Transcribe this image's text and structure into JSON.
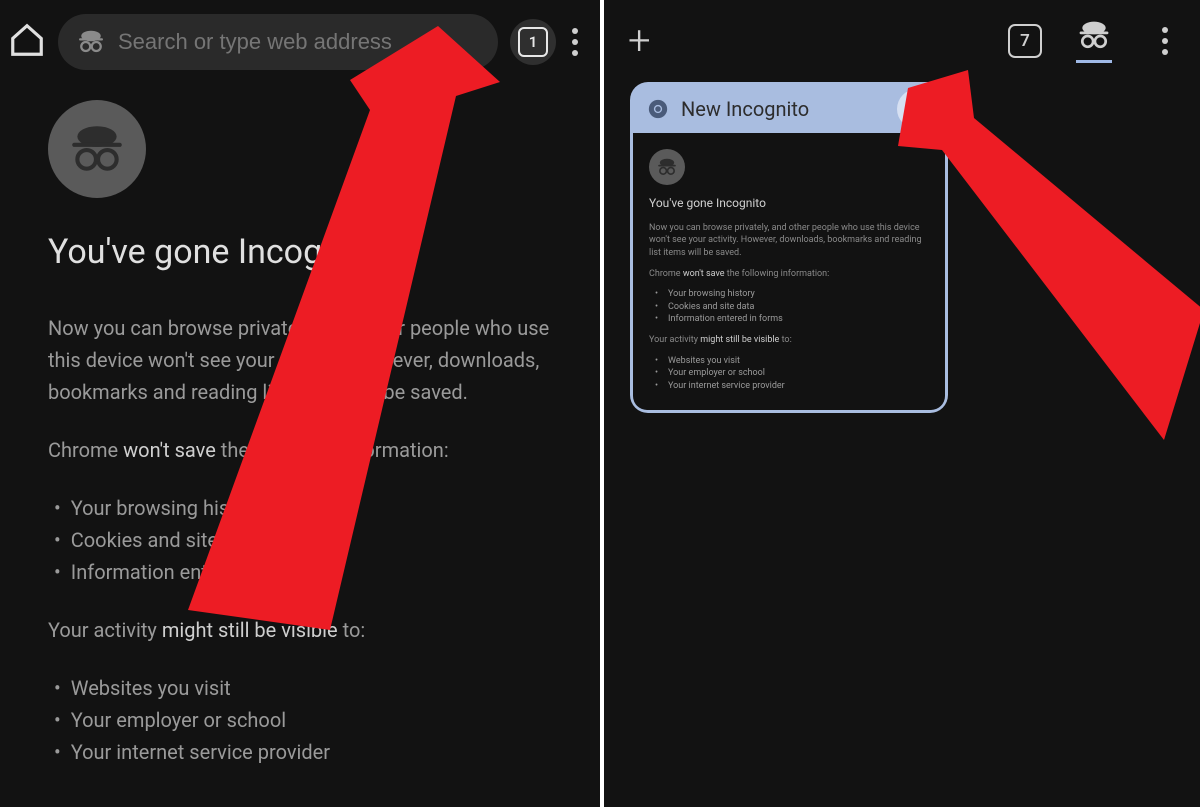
{
  "left": {
    "search_placeholder": "Search or type web address",
    "tab_count": "1",
    "heading": "You've gone Incognito",
    "intro": "Now you can browse privately, and other people who use this device won't see your activity. However, downloads, bookmarks and reading list items will be saved.",
    "wont_save_lead": "Chrome ",
    "wont_save_hl": "won't save",
    "wont_save_tail": " the following information:",
    "wont_save_items": [
      "Your browsing history",
      "Cookies and site data",
      "Information entered in forms"
    ],
    "visible_lead": "Your activity ",
    "visible_hl": "might still be visible",
    "visible_tail": " to:",
    "visible_items": [
      "Websites you visit",
      "Your employer or school",
      "Your internet service provider"
    ]
  },
  "right": {
    "tab_count": "7",
    "card_title": "New Incognito"
  },
  "thumb": {
    "heading": "You've gone Incognito",
    "intro": "Now you can browse privately, and other people who use this device won't see your activity. However, downloads, bookmarks and reading list items will be saved.",
    "wont_save_lead": "Chrome ",
    "wont_save_hl": "won't save",
    "wont_save_tail": " the following information:",
    "wont_save_items": [
      "Your browsing history",
      "Cookies and site data",
      "Information entered in forms"
    ],
    "visible_lead": "Your activity ",
    "visible_hl": "might still be visible",
    "visible_tail": " to:",
    "visible_items": [
      "Websites you visit",
      "Your employer or school",
      "Your internet service provider"
    ]
  }
}
